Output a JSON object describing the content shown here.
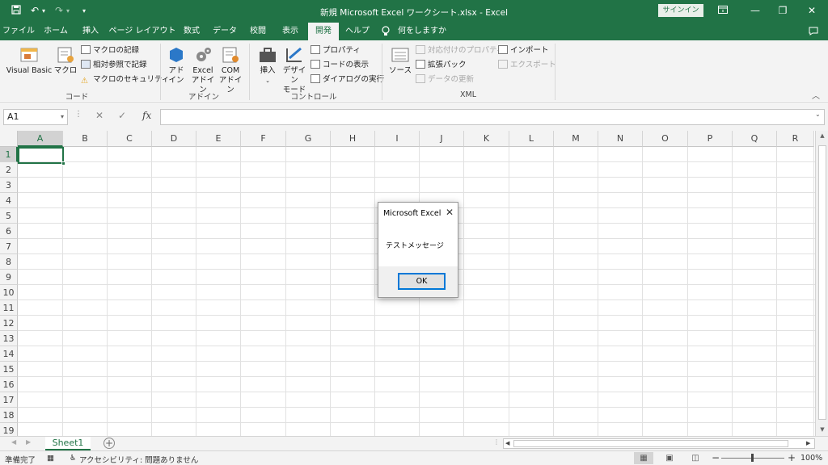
{
  "titlebar": {
    "title": "新規 Microsoft Excel ワークシート.xlsx  -  Excel",
    "signin": "サインイン",
    "save_icon": "save-icon",
    "undo_icon": "undo-icon",
    "redo_icon": "redo-icon"
  },
  "tabs": [
    "ファイル",
    "ホーム",
    "挿入",
    "ページ レイアウト",
    "数式",
    "データ",
    "校閲",
    "表示",
    "開発",
    "ヘルプ",
    "何をしますか"
  ],
  "active_tab": "開発",
  "ribbon": {
    "code": {
      "label": "コード",
      "vb": "Visual Basic",
      "macro": "マクロ",
      "record": "マクロの記録",
      "relative": "相対参照で記録",
      "security": "マクロのセキュリティ"
    },
    "addins": {
      "label": "アドイン",
      "addin": "アド\nイン",
      "excel": "Excel\nアドイン",
      "com": "COM\nアドイン"
    },
    "controls": {
      "label": "コントロール",
      "insert": "挿入",
      "design": "デザイン\nモード",
      "properties": "プロパティ",
      "viewcode": "コードの表示",
      "dialog": "ダイアログの実行"
    },
    "xml": {
      "label": "XML",
      "source": "ソース",
      "mapprops": "対応付けのプロパティ",
      "expansion": "拡張パック",
      "refresh": "データの更新",
      "import": "インポート",
      "export": "エクスポート"
    }
  },
  "formula_bar": {
    "namebox": "A1",
    "fx": "fx",
    "value": ""
  },
  "columns": [
    "A",
    "B",
    "C",
    "D",
    "E",
    "F",
    "G",
    "H",
    "I",
    "J",
    "K",
    "L",
    "M",
    "N",
    "O",
    "P",
    "Q",
    "R"
  ],
  "rows": [
    "1",
    "2",
    "3",
    "4",
    "5",
    "6",
    "7",
    "8",
    "9",
    "10",
    "11",
    "12",
    "13",
    "14",
    "15",
    "16",
    "17",
    "18",
    "19"
  ],
  "sheet_tab": "Sheet1",
  "status": {
    "ready": "準備完了",
    "accessibility": "アクセシビリティ: 問題ありません",
    "zoom": "100%"
  },
  "dialog": {
    "title": "Microsoft Excel",
    "message": "テストメッセージ",
    "ok": "OK"
  }
}
